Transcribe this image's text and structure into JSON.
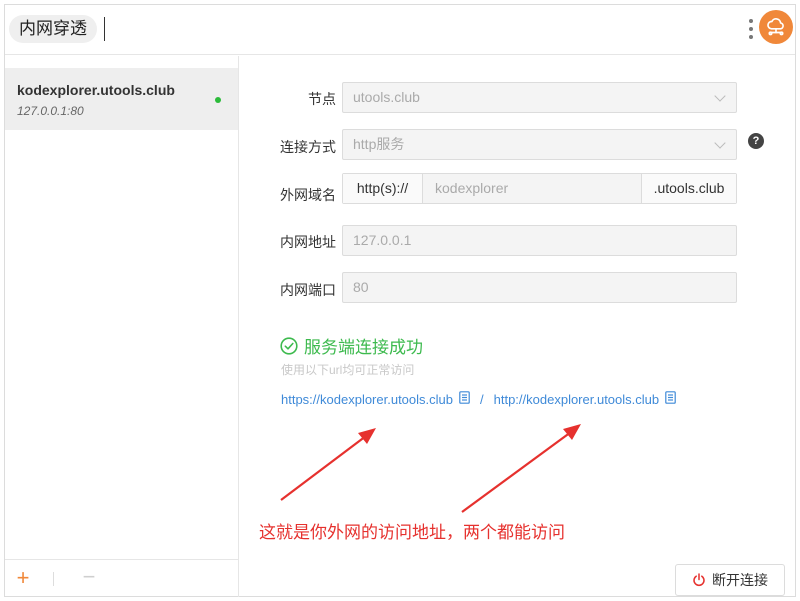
{
  "header": {
    "search_text": "内网穿透",
    "avatar_color": "#f0883a"
  },
  "sidebar": {
    "items": [
      {
        "title": "kodexplorer.utools.club",
        "subtitle": "127.0.0.1:80",
        "status_color": "#2bbb3a"
      }
    ],
    "add_label": "+",
    "remove_label": "−"
  },
  "form": {
    "node": {
      "label": "节点",
      "value": "utools.club"
    },
    "connection": {
      "label": "连接方式",
      "value": "http服务"
    },
    "domain": {
      "label": "外网域名",
      "prefix": "http(s)://",
      "value": "kodexplorer",
      "suffix": ".utools.club"
    },
    "address": {
      "label": "内网地址",
      "value": "127.0.0.1"
    },
    "port": {
      "label": "内网端口",
      "value": "80"
    },
    "help_label": "?"
  },
  "status": {
    "title": "服务端连接成功",
    "hint": "使用以下url均可正常访问",
    "urls": [
      "https://kodexplorer.utools.club",
      "http://kodexplorer.utools.club"
    ],
    "separator": "/",
    "success_color": "#3dba4e"
  },
  "annotation": {
    "text": "这就是你外网的访问地址，两个都能访问",
    "color": "#e6312e"
  },
  "footer": {
    "disconnect_label": "断开连接"
  },
  "icons": {
    "header": [
      "menu-dots-icon",
      "cloud-network-icon"
    ],
    "form": [
      "chevron-down-icon",
      "help-icon"
    ],
    "status": [
      "check-circle-icon",
      "copy-icon"
    ],
    "footer": [
      "power-icon"
    ]
  }
}
